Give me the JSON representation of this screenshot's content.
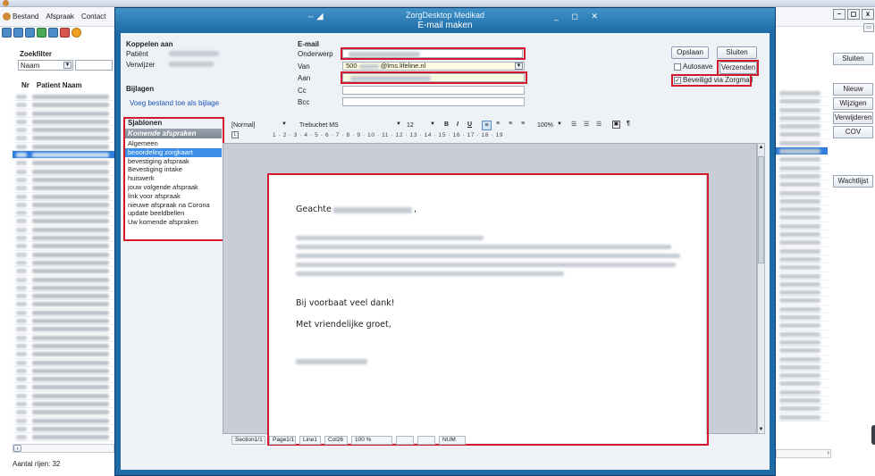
{
  "bg_app": {
    "menu": [
      "Bestand",
      "Afspraak",
      "Contact"
    ],
    "zoekfilter_label": "Zoekfilter",
    "filter_selected": "Naam",
    "list_header_nr": "Nr",
    "list_header_name": "Patient Naam",
    "row_count_label": "Aantal rijen: 32",
    "right_buttons": {
      "sluiten": "Sluiten",
      "nieuw": "Nieuw",
      "wijzigen": "Wijzigen",
      "verwijderen": "Verwijderen",
      "cov": "COV",
      "wachtlijst": "Wachtlijst"
    },
    "win_buttons": [
      "–",
      "◻",
      "x"
    ]
  },
  "dialog": {
    "app_title": "ZorgDesktop Medikad",
    "subtitle": "E-mail maken",
    "koppelen": {
      "heading": "Koppelen aan",
      "patient_label": "Patiënt",
      "verwijzer_label": "Verwijzer"
    },
    "bijlagen": {
      "heading": "Bijlagen",
      "add_link": "Voeg bestand toe als bijlage"
    },
    "email": {
      "heading": "E-mail",
      "onderwerp_label": "Onderwerp",
      "van_label": "Van",
      "van_prefix": "500",
      "van_domain": "@lms.lifeline.nl",
      "aan_label": "Aan",
      "cc_label": "Cc",
      "bcc_label": "Bcc"
    },
    "buttons": {
      "opslaan": "Opslaan",
      "sluiten": "Sluiten",
      "autosave": "Autosave",
      "verzenden": "Verzenden",
      "zorgmail": "Beveiligd via Zorgmail"
    },
    "autosave_checked": false,
    "zorgmail_checked": true,
    "templates": {
      "heading": "Sjablonen",
      "group": "Komende afspraken",
      "items": [
        "Algemeen",
        "beoordeling zorgkaart",
        "bevestiging afspraak",
        "Bevestiging intake",
        "huiswerk",
        "jouw volgende afspraak",
        "link voor afspraak",
        "nieuwe afspraak na Corona",
        "update beeldbellen",
        "Uw komende afspraken"
      ],
      "selected_index": 1
    },
    "editor": {
      "style": "[Normal]",
      "font": "Trebuchet MS",
      "size": "12",
      "zoom": "100%",
      "ruler": "1 · 2 · 3 · 4 · 5 · 6 · 7 · 8 · 9 · 10 · 11 · 12 · 13 · 14 · 15 · 16 · 17 · 18 · 19",
      "greeting": "Geachte",
      "greeting_suffix": ",",
      "thanks": "Bij voorbaat veel dank!",
      "closing": "Met vriendelijke groet,"
    },
    "statusbar": {
      "section": "Section1/1",
      "page": "Page1/1",
      "line": "Line1",
      "col": "Col26",
      "zoom": "100 %",
      "num": "NUM"
    }
  }
}
